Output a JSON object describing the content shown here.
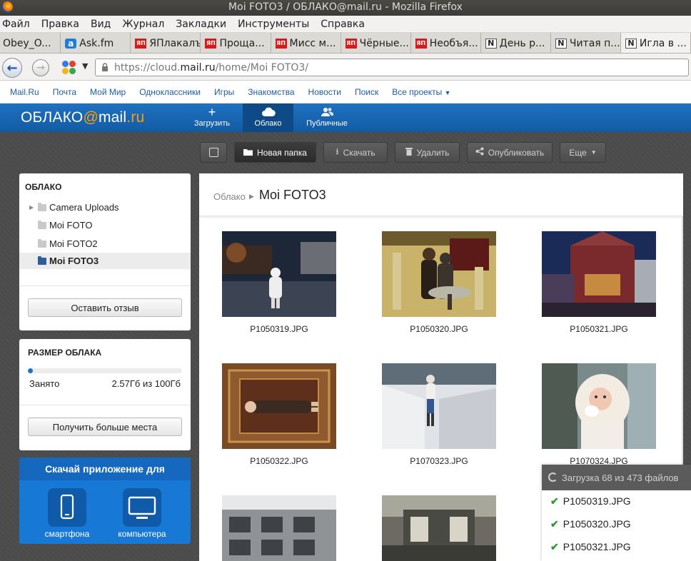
{
  "window": {
    "title": "Moi FOTO3 / ОБЛАКО@mail.ru - Mozilla Firefox"
  },
  "menu": [
    "Файл",
    "Правка",
    "Вид",
    "Журнал",
    "Закладки",
    "Инструменты",
    "Справка"
  ],
  "tabs": [
    {
      "label": "Obey_O...",
      "icon": "obey-favicon"
    },
    {
      "label": "Ask.fm",
      "icon": "askfm-favicon"
    },
    {
      "label": "ЯПлакалъ",
      "icon": "yaplakal-favicon"
    },
    {
      "label": "Проща...",
      "icon": "yaplakal-favicon"
    },
    {
      "label": "Мисс м...",
      "icon": "yaplakal-favicon"
    },
    {
      "label": "Чёрные...",
      "icon": "yaplakal-favicon"
    },
    {
      "label": "Необъя...",
      "icon": "yaplakal-favicon"
    },
    {
      "label": "День р...",
      "icon": "n-favicon"
    },
    {
      "label": "Читая п...",
      "icon": "n-favicon"
    },
    {
      "label": "Игла в ...",
      "icon": "n-favicon"
    }
  ],
  "favicon_text": {
    "yaplakal": "ЯП",
    "n": "N",
    "askfm": "a"
  },
  "url": {
    "prefix": "https://cloud.",
    "domain": "mail.ru",
    "path": "/home/Moi FOTO3/"
  },
  "portal_links": [
    "Mail.Ru",
    "Почта",
    "Мой Мир",
    "Одноклассники",
    "Игры",
    "Знакомства",
    "Новости",
    "Поиск",
    "Все проекты"
  ],
  "logo": {
    "part1": "ОБЛАКО",
    "at": "@",
    "part2": "mail",
    "dot_ru": ".ru"
  },
  "header_nav": [
    {
      "label": "Загрузить",
      "icon": "plus-icon"
    },
    {
      "label": "Облако",
      "icon": "cloud-icon",
      "active": true
    },
    {
      "label": "Публичные",
      "icon": "people-icon"
    }
  ],
  "toolbar": {
    "new_folder": "Новая папка",
    "download": "Скачать",
    "delete": "Удалить",
    "publish": "Опубликовать",
    "more": "Еще"
  },
  "sidebar": {
    "title": "ОБЛАКО",
    "folders": [
      {
        "name": "Camera Uploads",
        "has_children": true,
        "selected": false
      },
      {
        "name": "Moi FOTO",
        "has_children": false,
        "selected": false
      },
      {
        "name": "Moi FOTO2",
        "has_children": false,
        "selected": false
      },
      {
        "name": "Moi FOTO3",
        "has_children": false,
        "selected": true
      }
    ],
    "feedback_button": "Оставить отзыв"
  },
  "storage": {
    "title": "РАЗМЕР ОБЛАКА",
    "used_label": "Занято",
    "used_value": "2.57Гб из 100Гб",
    "used_fraction": 0.0257,
    "more_button": "Получить больше места"
  },
  "app_promo": {
    "title": "Скачай приложение для",
    "smartphone": "смартфона",
    "computer": "компьютера"
  },
  "breadcrumb": {
    "root": "Облако",
    "current": "Moi FOTO3"
  },
  "files": [
    "P1050319.JPG",
    "P1050320.JPG",
    "P1050321.JPG",
    "P1050322.JPG",
    "P1070323.JPG",
    "P1070324.JPG",
    "",
    ""
  ],
  "upload": {
    "status": "Загрузка 68 из 473 файлов",
    "done": [
      "P1050319.JPG",
      "P1050320.JPG",
      "P1050321.JPG"
    ]
  },
  "colors": {
    "brand_blue": "#1f71c1",
    "accent_orange": "#ff9e00",
    "workspace": "#4b4b4b",
    "check_green": "#2a9a2a"
  }
}
